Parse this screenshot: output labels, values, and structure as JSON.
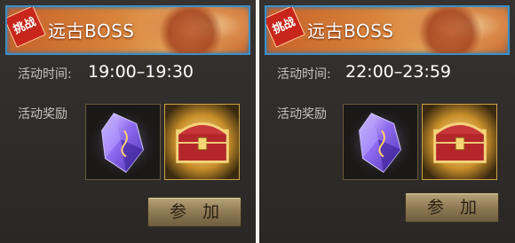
{
  "events": [
    {
      "tag": "挑战",
      "title": "远古BOSS",
      "time_label": "活动时间:",
      "time_value": "19:00–19:30",
      "reward_label": "活动奖励",
      "rewards": [
        {
          "icon": "purple-crystal-icon"
        },
        {
          "icon": "treasure-chest-icon"
        }
      ],
      "join_label": "参 加"
    },
    {
      "tag": "挑战",
      "title": "远古BOSS",
      "time_label": "活动时间:",
      "time_value": "22:00–23:59",
      "reward_label": "活动奖励",
      "rewards": [
        {
          "icon": "purple-crystal-icon"
        },
        {
          "icon": "treasure-chest-icon"
        }
      ],
      "join_label": "参 加"
    }
  ],
  "colors": {
    "banner_border": "#3d8fc6",
    "tag_red": "#c8251b",
    "panel_bg": "#2f2b29",
    "button_gold": "#a18d64"
  }
}
